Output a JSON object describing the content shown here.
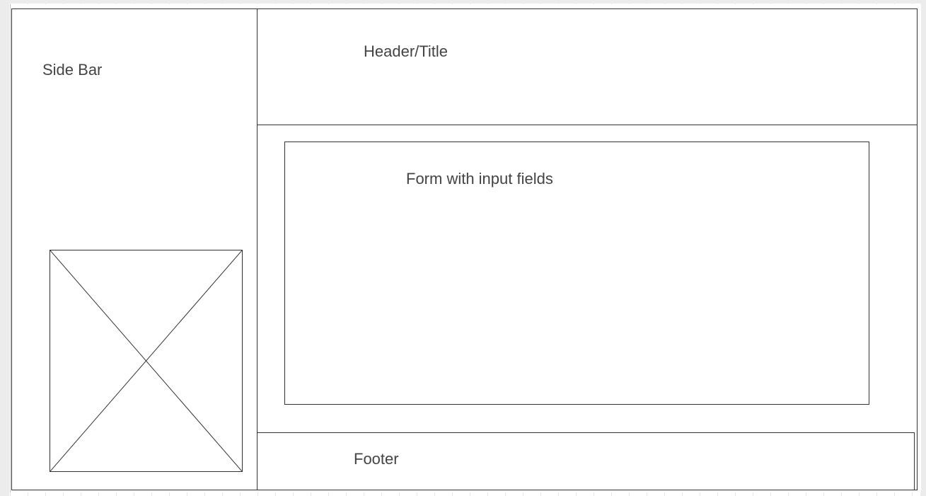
{
  "wireframe": {
    "sidebar": {
      "label": "Side Bar",
      "image_placeholder": "image-placeholder"
    },
    "header": {
      "label": "Header/Title"
    },
    "form": {
      "label": "Form with input fields"
    },
    "footer": {
      "label": "Footer"
    },
    "colors": {
      "stroke": "#333333",
      "text": "#444444",
      "grid": "#e6e6e6",
      "background": "#ffffff"
    }
  }
}
